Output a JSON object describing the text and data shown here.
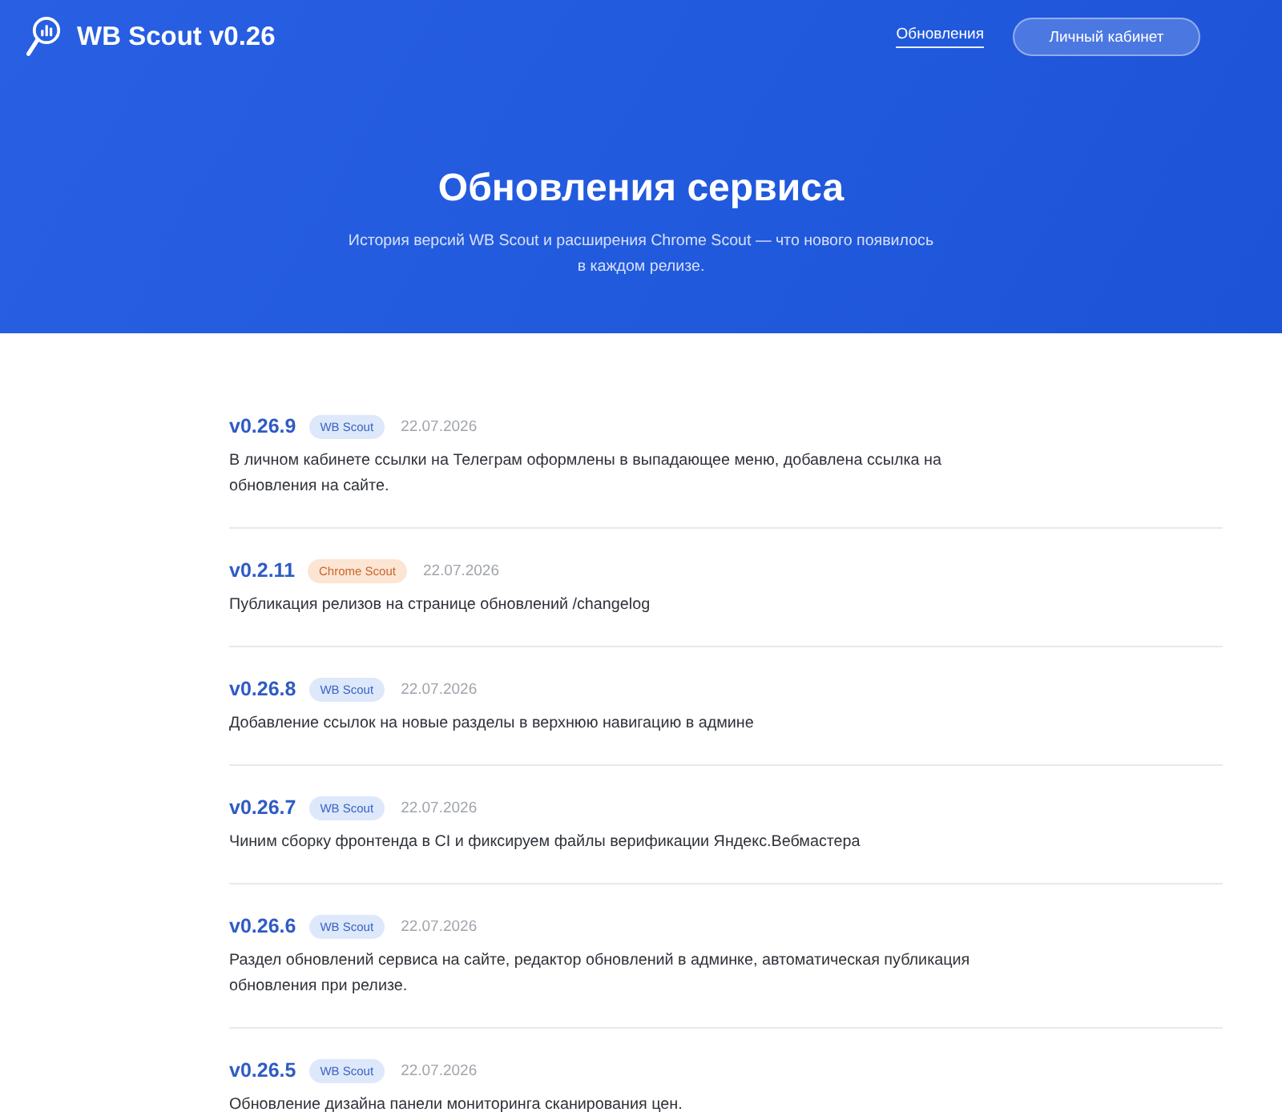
{
  "header": {
    "brand": "WB Scout v0.26",
    "nav_links": [
      {
        "label": "Обновления",
        "selected": true
      }
    ],
    "account_button": "Личный кабинет"
  },
  "hero": {
    "title": "Обновления сервиса",
    "subtitle": "История версий WB Scout и расширения Chrome Scout — что нового появилось в каждом релизе."
  },
  "releases": [
    {
      "version": "v0.26.9",
      "tag": {
        "label": "WB Scout",
        "kind": "wb"
      },
      "date": "22.07.2026",
      "description": "В личном кабинете ссылки на Телеграм оформлены в выпадающее меню, добавлена ссылка на обновления на сайте."
    },
    {
      "version": "v0.2.11",
      "tag": {
        "label": "Chrome Scout",
        "kind": "chrome"
      },
      "date": "22.07.2026",
      "description": "Публикация релизов на странице обновлений /changelog"
    },
    {
      "version": "v0.26.8",
      "tag": {
        "label": "WB Scout",
        "kind": "wb"
      },
      "date": "22.07.2026",
      "description": "Добавление ссылок на новые разделы в верхнюю навигацию в админе"
    },
    {
      "version": "v0.26.7",
      "tag": {
        "label": "WB Scout",
        "kind": "wb"
      },
      "date": "22.07.2026",
      "description": "Чиним сборку фронтенда в CI и фиксируем файлы верификации Яндекс.Вебмастера"
    },
    {
      "version": "v0.26.6",
      "tag": {
        "label": "WB Scout",
        "kind": "wb"
      },
      "date": "22.07.2026",
      "description": "Раздел обновлений сервиса на сайте, редактор обновлений в админке, автоматическая публикация обновления при релизе."
    },
    {
      "version": "v0.26.5",
      "tag": {
        "label": "WB Scout",
        "kind": "wb"
      },
      "date": "22.07.2026",
      "description": "Обновление дизайна панели мониторинга сканирования цен."
    }
  ]
}
